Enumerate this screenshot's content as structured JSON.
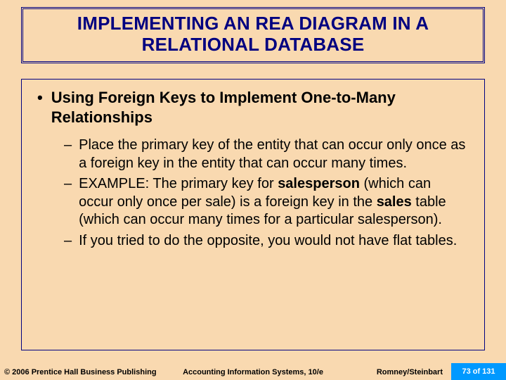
{
  "title": {
    "line1": "IMPLEMENTING AN REA DIAGRAM IN A",
    "line2": "RELATIONAL DATABASE"
  },
  "main_bullet": "Using Foreign Keys to Implement One-to-Many Relationships",
  "sub_bullets": {
    "s1": "Place the primary key of the entity that can occur only once as a foreign key in the entity that can occur many times.",
    "s2_a": "EXAMPLE:  The primary key for ",
    "s2_b": "salesperson",
    "s2_c": " (which can occur only once per sale) is a foreign key in the ",
    "s2_d": "sales",
    "s2_e": " table (which can occur many times for a particular salesperson).",
    "s3": "If you tried to do the opposite, you would not have flat tables."
  },
  "footer": {
    "copyright": "© 2006 Prentice Hall Business Publishing",
    "center": "Accounting Information Systems, 10/e",
    "authors": "Romney/Steinbart",
    "page": "73 of 131"
  }
}
